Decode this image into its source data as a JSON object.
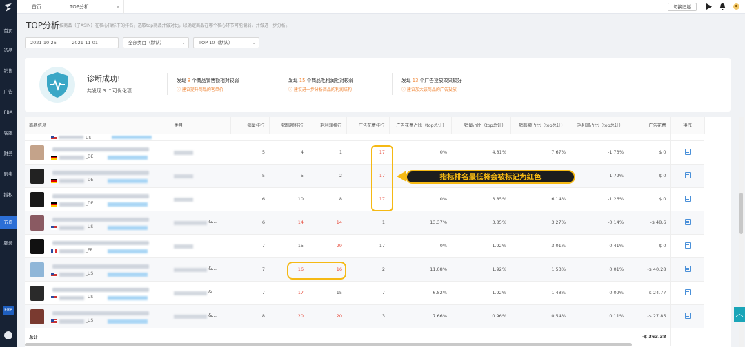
{
  "sidebar": {
    "items": [
      {
        "label": "首页"
      },
      {
        "label": "选品"
      },
      {
        "label": "销售"
      },
      {
        "label": "广告"
      },
      {
        "label": "FBA"
      },
      {
        "label": "客服"
      },
      {
        "label": "财务"
      },
      {
        "label": "跟卖"
      },
      {
        "label": "授权"
      },
      {
        "label": "方舟"
      },
      {
        "label": "服务"
      }
    ],
    "badge": "ERP"
  },
  "tabs": [
    {
      "label": "首页"
    },
    {
      "label": "TOP分析",
      "close": "×"
    }
  ],
  "header": {
    "switch_label": "切换旧版"
  },
  "page": {
    "title": "TOP分析",
    "description": "按商品（子ASIN）在核心指标下的排名，选取top商品并做对比，以确定商品在哪个核心环节可能偏弱，并做进一步分析。"
  },
  "filters": {
    "date_start": "2021-10-26",
    "date_sep": "-",
    "date_end": "2021-11-01",
    "category": "全部类目（默认）",
    "top": "TOP 10（默认）"
  },
  "summary": {
    "title": "诊断成功!",
    "sub_prefix": "共发现",
    "sub_count": "3",
    "sub_suffix": "个可优化项",
    "findings": [
      {
        "prefix": "发现",
        "count": "8",
        "suffix": "个商品销售额相对较弱",
        "tip": "建议提升商品的客单价"
      },
      {
        "prefix": "发现",
        "count": "15",
        "suffix": "个商品毛利润相对较弱",
        "tip": "建议进一步分析商品的利润结构"
      },
      {
        "prefix": "发现",
        "count": "13",
        "suffix": "个广告投放效果较好",
        "tip": "建议加大该商品的广告投放"
      }
    ]
  },
  "table": {
    "headers": [
      "商品信息",
      "类目",
      "销量排行",
      "销售额排行",
      "毛利润排行",
      "广告花费排行",
      "广告花费占比（top总计）",
      "销量占比（top总计）",
      "销售额占比（top总计）",
      "毛利润占比（top总计）",
      "广告花费",
      "操作"
    ],
    "rows": [
      {
        "market": "_DE",
        "amp": "",
        "sales": "5",
        "revenue": "4",
        "profit": "1",
        "ad": "17",
        "ad_share": "0%",
        "sales_share": "4.81%",
        "rev_share": "7.67%",
        "profit_share": "-1.73%",
        "ad_spend": "$ 0",
        "red": [
          "ad"
        ]
      },
      {
        "market": "_DE",
        "amp": "",
        "sales": "5",
        "revenue": "5",
        "profit": "2",
        "ad": "17",
        "ad_share": "0%",
        "sales_share": "1.92%",
        "rev_share": "1.92%",
        "profit_share": "-1.72%",
        "ad_spend": "$ 0",
        "red": [
          "ad"
        ]
      },
      {
        "market": "_DE",
        "amp": "",
        "sales": "6",
        "revenue": "10",
        "profit": "8",
        "ad": "17",
        "ad_share": "0%",
        "sales_share": "3.85%",
        "rev_share": "6.14%",
        "profit_share": "-1.26%",
        "ad_spend": "$ 0",
        "red": [
          "ad"
        ]
      },
      {
        "market": "_US",
        "amp": "&...",
        "sales": "6",
        "revenue": "14",
        "profit": "14",
        "ad": "1",
        "ad_share": "13.37%",
        "sales_share": "3.85%",
        "rev_share": "3.27%",
        "profit_share": "-0.14%",
        "ad_spend": "-$ 48.6",
        "red": [
          "revenue",
          "profit"
        ]
      },
      {
        "market": "_FR",
        "amp": "",
        "sales": "7",
        "revenue": "15",
        "profit": "29",
        "ad": "17",
        "ad_share": "0%",
        "sales_share": "1.92%",
        "rev_share": "3.01%",
        "profit_share": "0.41%",
        "ad_spend": "$ 0",
        "red": [
          "profit"
        ]
      },
      {
        "market": "_US",
        "amp": "&...",
        "sales": "7",
        "revenue": "16",
        "profit": "16",
        "ad": "2",
        "ad_share": "11.08%",
        "sales_share": "1.92%",
        "rev_share": "1.53%",
        "profit_share": "0.01%",
        "ad_spend": "-$ 40.28",
        "red": [
          "revenue",
          "profit"
        ]
      },
      {
        "market": "_US",
        "amp": "&...",
        "sales": "7",
        "revenue": "17",
        "profit": "15",
        "ad": "7",
        "ad_share": "6.82%",
        "sales_share": "1.92%",
        "rev_share": "1.48%",
        "profit_share": "-0.09%",
        "ad_spend": "-$ 24.77",
        "red": [
          "revenue"
        ]
      },
      {
        "market": "_US",
        "amp": "&...",
        "sales": "8",
        "revenue": "20",
        "profit": "20",
        "ad": "3",
        "ad_share": "7.66%",
        "sales_share": "0.96%",
        "rev_share": "0.54%",
        "profit_share": "0.11%",
        "ad_spend": "-$ 27.85",
        "red": [
          "revenue",
          "profit"
        ]
      }
    ],
    "total": {
      "label": "总计",
      "dash": "—",
      "ad_spend": "-$ 363.38"
    },
    "partial_row_market": "_US"
  },
  "annotation": {
    "callout": "指标排名最低将会被标记为红色"
  },
  "back_to_top": "︿",
  "colors": {
    "accent": "#2c6fd6",
    "warning": "#f0883a",
    "red": "#e74c3c",
    "highlight": "#f5b914"
  }
}
